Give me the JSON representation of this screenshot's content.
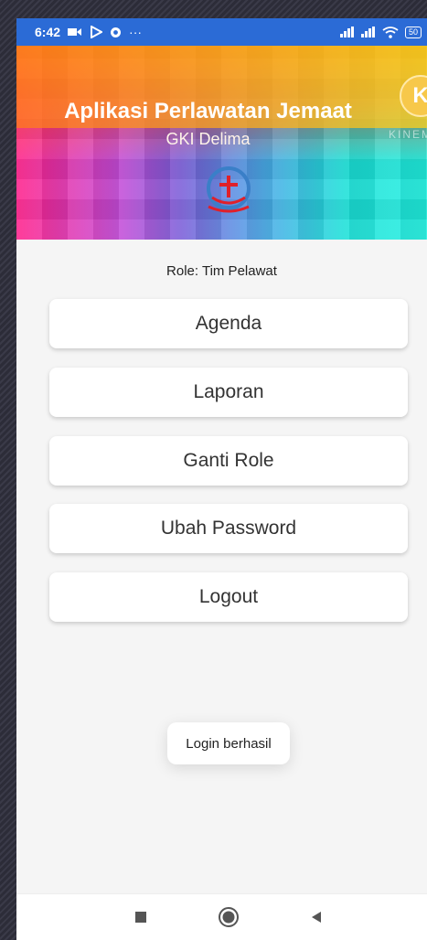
{
  "status_bar": {
    "time": "6:42",
    "battery": "50",
    "left_icons": [
      "video-call-icon",
      "play-store-icon",
      "sync-icon",
      "more-icon"
    ],
    "right_icons": [
      "signal-icon",
      "signal-icon",
      "wifi-icon",
      "battery-icon"
    ]
  },
  "header": {
    "title": "Aplikasi Perlawatan Jemaat",
    "subtitle": "GKI Delima",
    "logo_icon": "church-logo-icon"
  },
  "watermark": {
    "badge": "K",
    "text": "KINEMA"
  },
  "role_label": "Role: Tim Pelawat",
  "menu": [
    {
      "label": "Agenda"
    },
    {
      "label": "Laporan"
    },
    {
      "label": "Ganti Role"
    },
    {
      "label": "Ubah Password"
    },
    {
      "label": "Logout"
    }
  ],
  "toast": "Login berhasil",
  "navigation": {
    "icons": [
      "recents-square-icon",
      "home-circle-icon",
      "back-triangle-icon"
    ]
  },
  "colors": {
    "status_bar": "#2b6bd6",
    "background": "#f5f5f5",
    "button": "#ffffff"
  }
}
